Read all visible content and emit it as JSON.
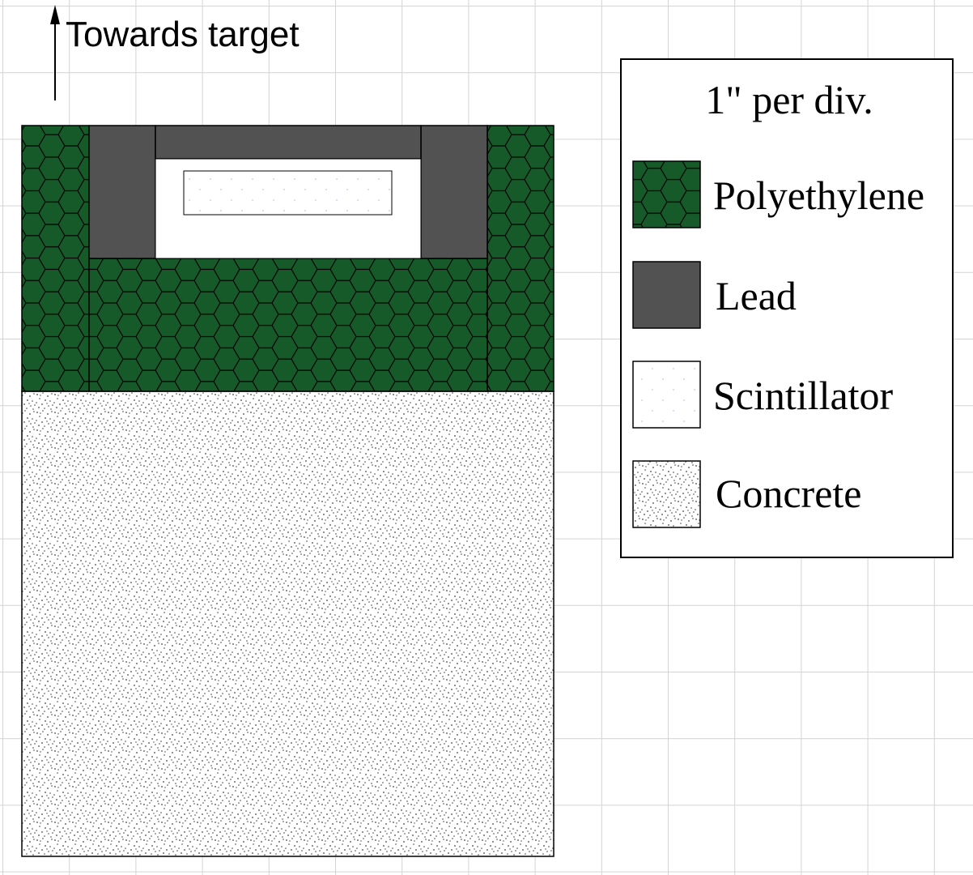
{
  "arrow": {
    "label": "Towards target"
  },
  "legend": {
    "title": "1\" per div.",
    "items": [
      {
        "key": "polyethylene",
        "label": "Polyethylene"
      },
      {
        "key": "lead",
        "label": "Lead"
      },
      {
        "key": "scintillator",
        "label": "Scintillator"
      },
      {
        "key": "concrete",
        "label": "Concrete"
      }
    ]
  },
  "colors": {
    "grid": "#d4d4d4",
    "polyethylene": "#175a2a",
    "lead": "#525252",
    "scintillator": "#6a17e6",
    "concrete_dots": "#444444",
    "outline": "#000000"
  }
}
